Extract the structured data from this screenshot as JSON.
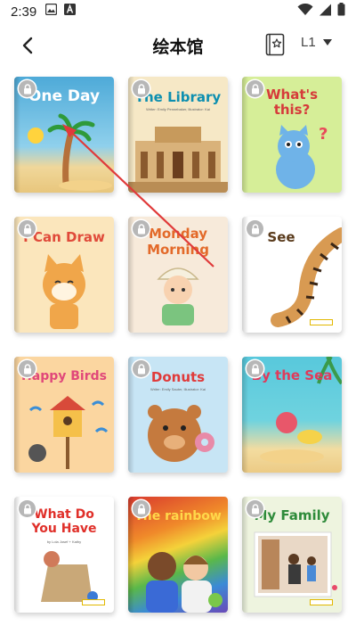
{
  "status": {
    "time": "2:39"
  },
  "header": {
    "title": "绘本馆",
    "level": "L1"
  },
  "books": [
    {
      "title": "One Day",
      "title_color": "#ffffff",
      "bg": "#5fb8e0"
    },
    {
      "title": "The Library",
      "title_color": "#0d8fb0",
      "bg": "#f7e9c9",
      "subtitle": "Writer: Emily Pennebaker, Illustrator: Kai"
    },
    {
      "title": "What's this?",
      "title_color": "#d63a3a",
      "bg": "#d7ee9c"
    },
    {
      "title": "I Can Draw",
      "title_color": "#e04a3a",
      "bg": "#fbe8c0"
    },
    {
      "title": "Monday Morning",
      "title_color": "#e36a2a",
      "bg": "#f8ebd5"
    },
    {
      "title": "See",
      "title_color": "#5a3b1c",
      "bg": "#ffffff"
    },
    {
      "title": "Happy Birds",
      "title_color": "#e0487a",
      "bg": "#fbd9a5"
    },
    {
      "title": "Donuts",
      "title_color": "#e03a3a",
      "bg": "#c8e6f6",
      "subtitle": "Writer: Emily Sauter, Illustrator: Kai"
    },
    {
      "title": "By the Sea",
      "title_color": "#e03a5a",
      "bg": "#56c6d9"
    },
    {
      "title": "What Do You Have",
      "title_color": "#e0302a",
      "bg": "#ffffff",
      "subtitle": "by Lola Josef + Kathy"
    },
    {
      "title": "The rainbow",
      "title_color": "#ffd84a",
      "bg": "#d43a32"
    },
    {
      "title": "My Family",
      "title_color": "#2e8b3a",
      "bg": "#eef5e0"
    }
  ]
}
